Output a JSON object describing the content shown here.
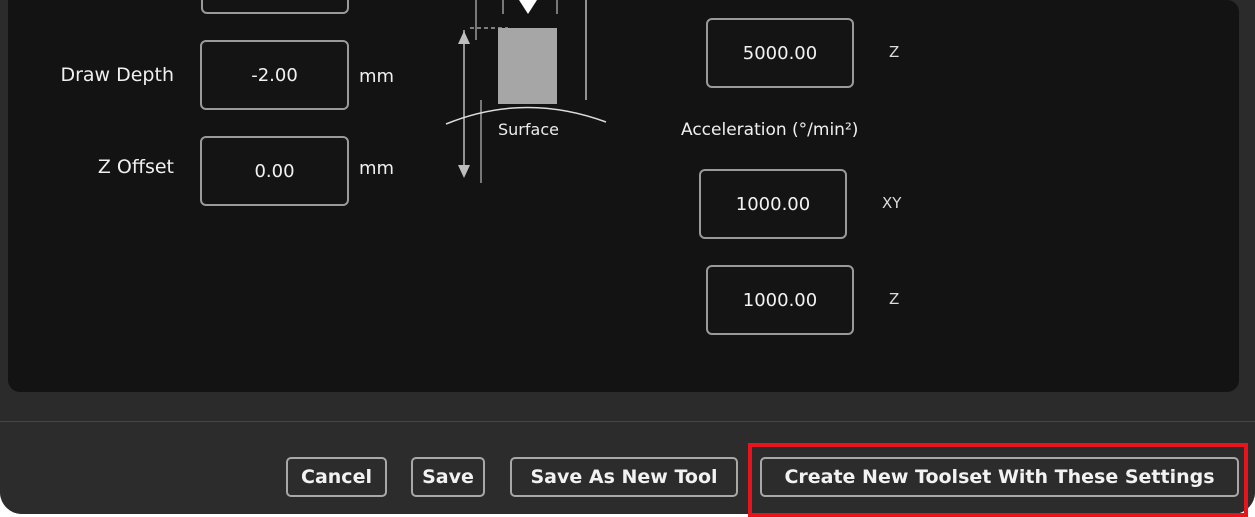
{
  "settings": {
    "draw_depth": {
      "label": "Draw Depth",
      "value": "-2.00",
      "unit": "mm"
    },
    "z_offset": {
      "label": "Z Offset",
      "value": "0.00",
      "unit": "mm"
    }
  },
  "diagram": {
    "surface_label": "Surface"
  },
  "feedrate": {
    "z_value": "5000.00",
    "z_axis": "Z"
  },
  "acceleration": {
    "label": "Acceleration (°/min²)",
    "xy_value": "1000.00",
    "xy_axis": "XY",
    "z_value": "1000.00",
    "z_axis": "Z"
  },
  "footer": {
    "cancel": "Cancel",
    "save": "Save",
    "save_as_new_tool": "Save As New Tool",
    "create_toolset": "Create New Toolset With These Settings"
  },
  "colors": {
    "panel": "#131313",
    "footer": "#2c2c2c",
    "highlight": "#e8141b"
  }
}
